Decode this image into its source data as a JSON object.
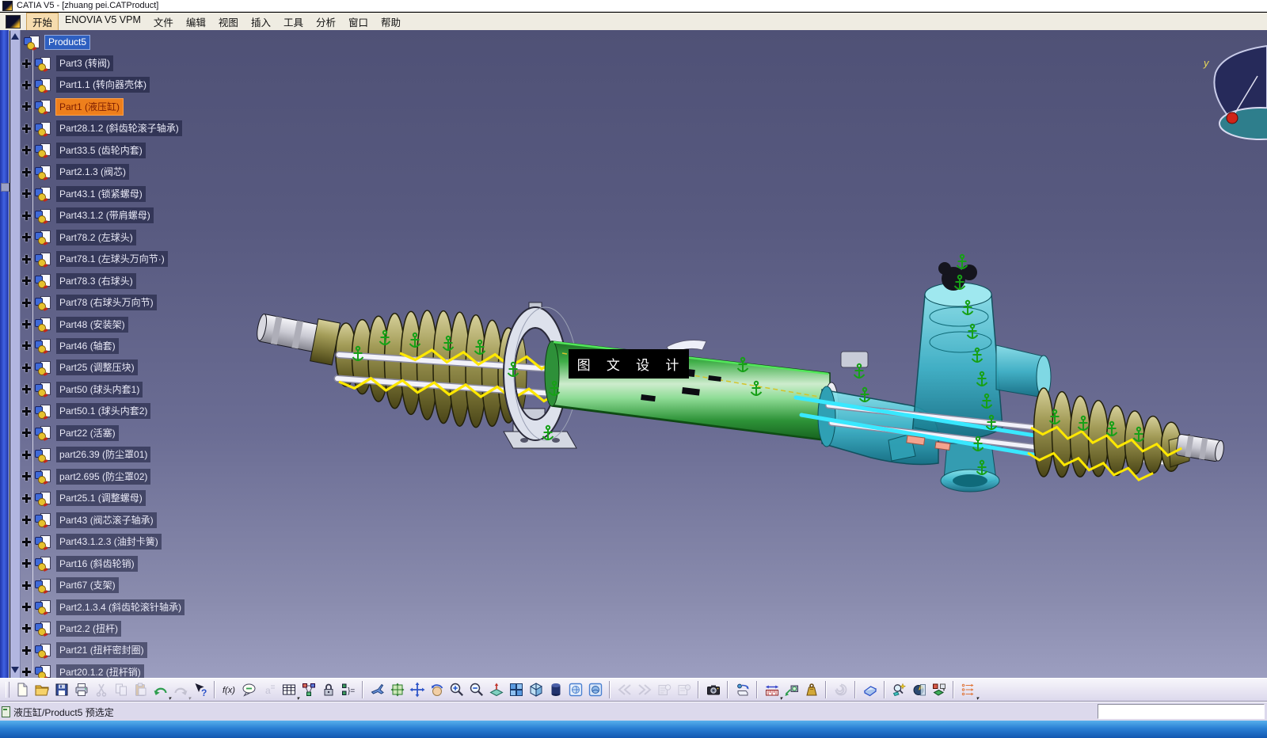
{
  "window": {
    "title": "CATIA V5 - [zhuang pei.CATProduct]"
  },
  "menubar": {
    "items": [
      "开始",
      "ENOVIA V5 VPM",
      "文件",
      "编辑",
      "视图",
      "插入",
      "工具",
      "分析",
      "窗口",
      "帮助"
    ],
    "active_item": "开始"
  },
  "tree": {
    "root": {
      "label": "Product5",
      "selected": true
    },
    "items": [
      {
        "label": "Part3 (转阀)"
      },
      {
        "label": "Part1.1 (转向器壳体)"
      },
      {
        "label": "Part1 (液压缸)",
        "preselected": true
      },
      {
        "label": "Part28.1.2 (斜齿轮滚子轴承)"
      },
      {
        "label": "Part33.5 (齿轮内套)"
      },
      {
        "label": "Part2.1.3 (阀芯)"
      },
      {
        "label": "Part43.1 (锁紧螺母)"
      },
      {
        "label": "Part43.1.2 (带肩螺母)"
      },
      {
        "label": "Part78.2 (左球头)"
      },
      {
        "label": "Part78.1 (左球头万向节·)"
      },
      {
        "label": "Part78.3 (右球头)"
      },
      {
        "label": "Part78 (右球头万向节)"
      },
      {
        "label": "Part48 (安装架)"
      },
      {
        "label": "Part46 (轴套)"
      },
      {
        "label": "Part25 (调整压块)"
      },
      {
        "label": "Part50 (球头内套1)"
      },
      {
        "label": "Part50.1 (球头内套2)"
      },
      {
        "label": "Part22 (活塞)"
      },
      {
        "label": "part26.39 (防尘罩01)"
      },
      {
        "label": "part2.695 (防尘罩02)"
      },
      {
        "label": "Part25.1 (调整螺母)"
      },
      {
        "label": "Part43 (阀芯滚子轴承)"
      },
      {
        "label": "Part43.1.2.3 (油封卡簧)"
      },
      {
        "label": "Part16 (斜齿轮销)"
      },
      {
        "label": "Part67 (支架)"
      },
      {
        "label": "Part2.1.3.4 (斜齿轮滚针轴承)"
      },
      {
        "label": "Part2.2 (扭杆)"
      },
      {
        "label": "Part21 (扭杆密封圈)"
      },
      {
        "label": "Part20.1.2 (扭杆销)"
      }
    ]
  },
  "viewport": {
    "watermark": "图 文 设 计",
    "compass_axis_label": "y",
    "colors": {
      "background_top": "#4f5176",
      "background_bottom": "#9c9ec0",
      "cylinder_green": "#3fae48",
      "housing_teal": "#3fb8cc",
      "bellows_khaki": "#a39c58",
      "highlight_yellow": "#ffe800",
      "highlight_cyan": "#39e8ff",
      "constraint_green": "#17a017",
      "preselect_orange": "#ee7f1c",
      "selection_blue": "#2e5fc0"
    }
  },
  "toolbar": {
    "groups": [
      [
        {
          "name": "new-document"
        },
        {
          "name": "open-folder"
        },
        {
          "name": "save"
        },
        {
          "name": "print"
        },
        {
          "name": "cut",
          "disabled": true
        },
        {
          "name": "copy",
          "disabled": true
        },
        {
          "name": "paste",
          "disabled": true
        },
        {
          "name": "undo",
          "dropdown": true
        },
        {
          "name": "redo",
          "disabled": true,
          "dropdown": true
        },
        {
          "name": "context-help"
        }
      ],
      [
        {
          "name": "formula-fx"
        },
        {
          "name": "annotation"
        },
        {
          "name": "knowledge",
          "disabled": true
        },
        {
          "name": "design-table",
          "dropdown": true
        },
        {
          "name": "graph-links"
        },
        {
          "name": "lock"
        },
        {
          "name": "tree-structure"
        }
      ],
      [
        {
          "name": "fly-mode"
        },
        {
          "name": "fit-all"
        },
        {
          "name": "pan"
        },
        {
          "name": "rotate"
        },
        {
          "name": "zoom-in"
        },
        {
          "name": "zoom-out"
        },
        {
          "name": "normal-view"
        },
        {
          "name": "multi-view"
        },
        {
          "name": "iso-view"
        },
        {
          "name": "render-style"
        },
        {
          "name": "view-mode-1"
        },
        {
          "name": "view-mode-2"
        }
      ],
      [
        {
          "name": "rewind",
          "disabled": true
        },
        {
          "name": "fast-forward",
          "disabled": true
        },
        {
          "name": "viewpoint-copy",
          "disabled": true
        },
        {
          "name": "viewpoint-paste",
          "disabled": true
        }
      ],
      [
        {
          "name": "camera-capture"
        }
      ],
      [
        {
          "name": "turntable"
        }
      ],
      [
        {
          "name": "measure-between",
          "dropdown": true
        },
        {
          "name": "measure-item"
        },
        {
          "name": "measure-inertia"
        }
      ],
      [
        {
          "name": "swirl-tool",
          "disabled": true
        }
      ],
      [
        {
          "name": "clean-eraser"
        }
      ],
      [
        {
          "name": "clash-analysis"
        },
        {
          "name": "sectioning"
        },
        {
          "name": "distance-band"
        }
      ],
      [
        {
          "name": "catalog-browser",
          "dropdown": true
        }
      ]
    ]
  },
  "statusbar": {
    "message": "液压缸/Product5 预选定",
    "command_value": ""
  }
}
